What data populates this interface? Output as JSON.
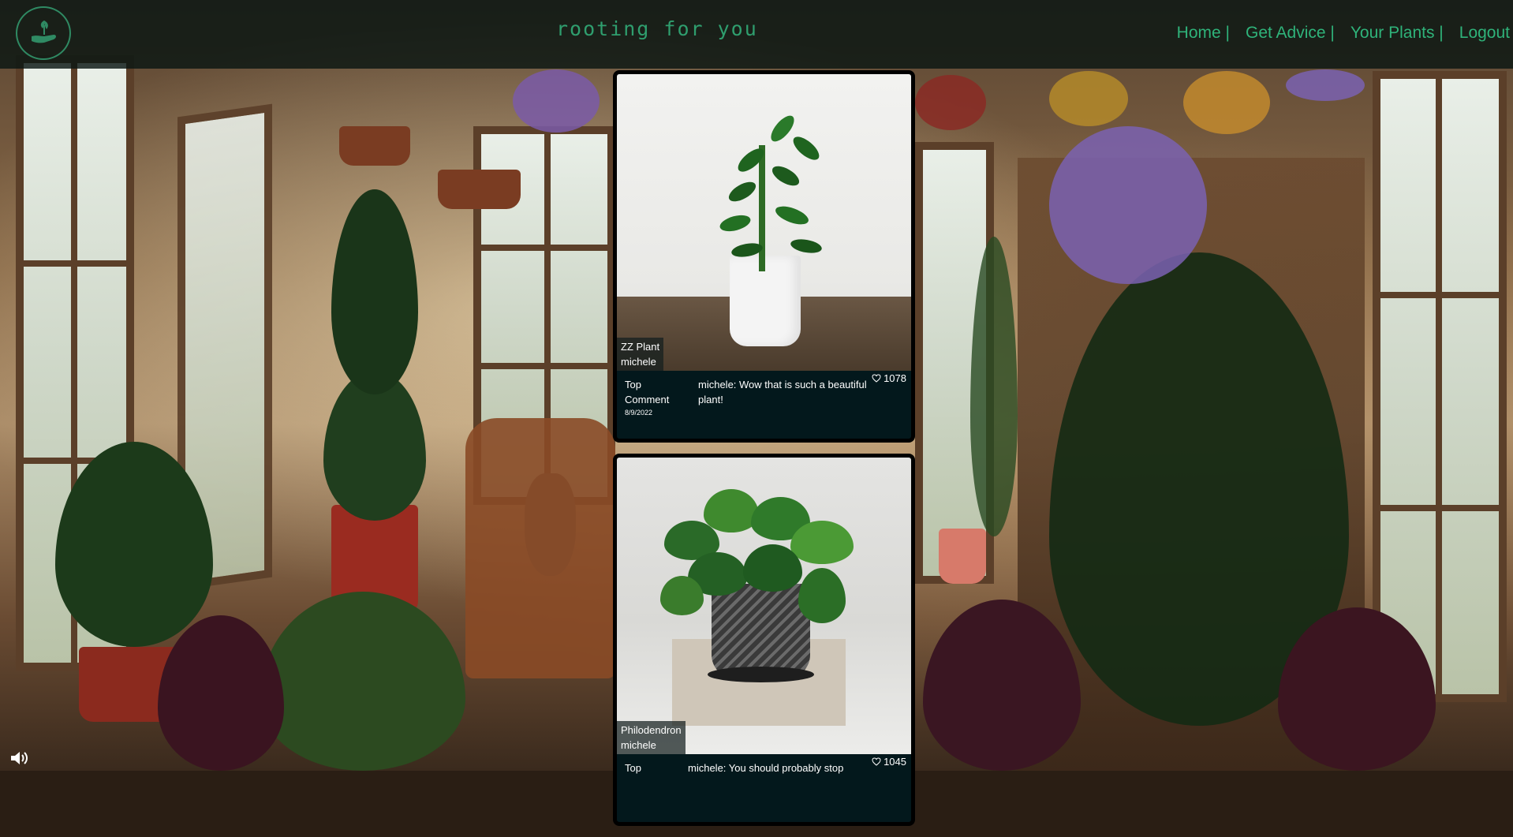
{
  "header": {
    "brand": "rooting for you",
    "nav": [
      {
        "label": "Home |"
      },
      {
        "label": "Get Advice |"
      },
      {
        "label": "Your Plants |"
      },
      {
        "label": "Logout"
      }
    ]
  },
  "posts": [
    {
      "plant_name": "ZZ Plant",
      "user": "michele",
      "likes": "1078",
      "top_label": "Top Comment",
      "top_comment": "michele: Wow that is such a beautiful plant!",
      "date": "8/9/2022"
    },
    {
      "plant_name": "Philodendron",
      "user": "michele",
      "likes": "1045",
      "top_label": "Top",
      "top_comment": "michele: You should probably stop",
      "date": ""
    }
  ],
  "icons": {
    "logo": "hand-sprout-icon",
    "like": "heart-outline-icon",
    "sound": "speaker-volume-icon"
  },
  "colors": {
    "header_bg": "#0a1612",
    "accent": "#2fb37a",
    "card_bg": "#03181c"
  }
}
